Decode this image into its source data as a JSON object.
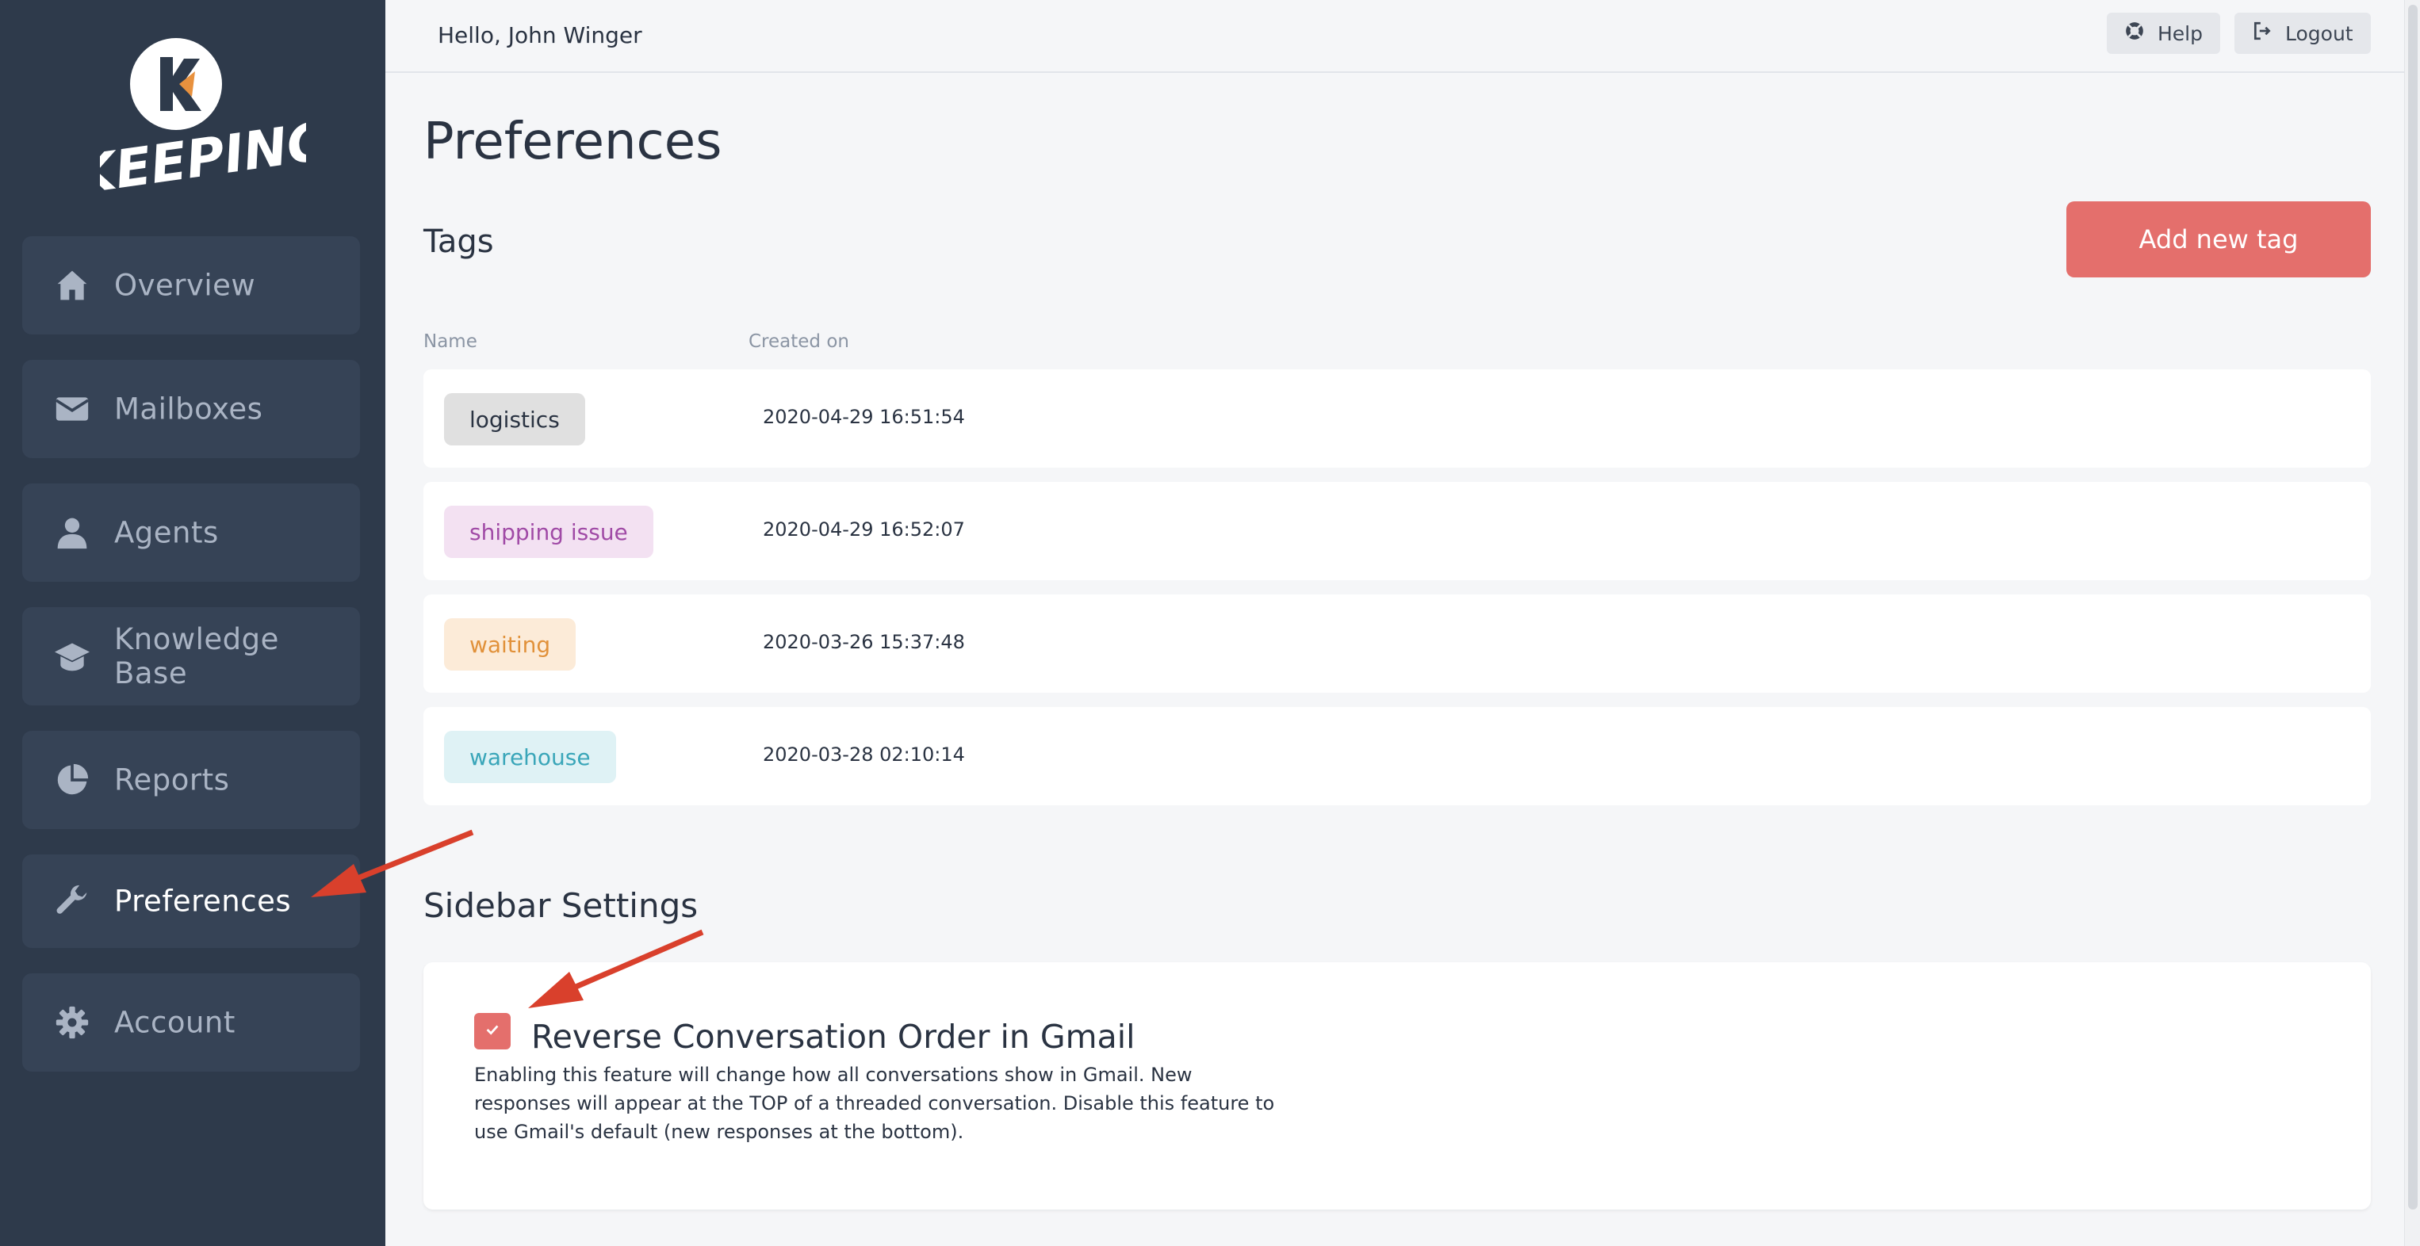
{
  "brand": {
    "logo_text": "KEEPING",
    "logo_letter": "K"
  },
  "sidebar": {
    "items": [
      {
        "label": "Overview",
        "icon": "home-icon",
        "active": false
      },
      {
        "label": "Mailboxes",
        "icon": "envelope-icon",
        "active": false
      },
      {
        "label": "Agents",
        "icon": "user-icon",
        "active": false
      },
      {
        "label": "Knowledge Base",
        "icon": "graduation-cap-icon",
        "active": false
      },
      {
        "label": "Reports",
        "icon": "pie-chart-icon",
        "active": false
      },
      {
        "label": "Preferences",
        "icon": "wrench-icon",
        "active": true
      },
      {
        "label": "Account",
        "icon": "gear-icon",
        "active": false
      }
    ]
  },
  "header": {
    "greeting": "Hello, John Winger",
    "help_label": "Help",
    "logout_label": "Logout"
  },
  "main": {
    "title": "Preferences",
    "tags": {
      "title": "Tags",
      "add_button_label": "Add new tag",
      "columns": [
        "Name",
        "Created on"
      ],
      "rows": [
        {
          "name": "logistics",
          "created_on": "2020-04-29 16:51:54",
          "bg": "#e0e0e0",
          "fg": "#2a3342"
        },
        {
          "name": "shipping issue",
          "created_on": "2020-04-29 16:52:07",
          "bg": "#f3e1f2",
          "fg": "#a04aa6"
        },
        {
          "name": "waiting",
          "created_on": "2020-03-26 15:37:48",
          "bg": "#fcebd8",
          "fg": "#e1913a"
        },
        {
          "name": "warehouse",
          "created_on": "2020-03-28 02:10:14",
          "bg": "#dff2f5",
          "fg": "#3aa6b9"
        }
      ]
    },
    "sidebar_settings": {
      "title": "Sidebar Settings",
      "reverse_order": {
        "checked": true,
        "label": "Reverse Conversation Order in Gmail",
        "description": "Enabling this feature will change how all conversations show in Gmail. New responses will appear at the TOP of a threaded conversation. Disable this feature to use Gmail's default (new responses at the bottom)."
      }
    }
  },
  "colors": {
    "sidebar_bg": "#2e3a4b",
    "nav_item_bg": "#364356",
    "accent": "#e46f6c",
    "annotation_arrow": "#d9402c"
  }
}
